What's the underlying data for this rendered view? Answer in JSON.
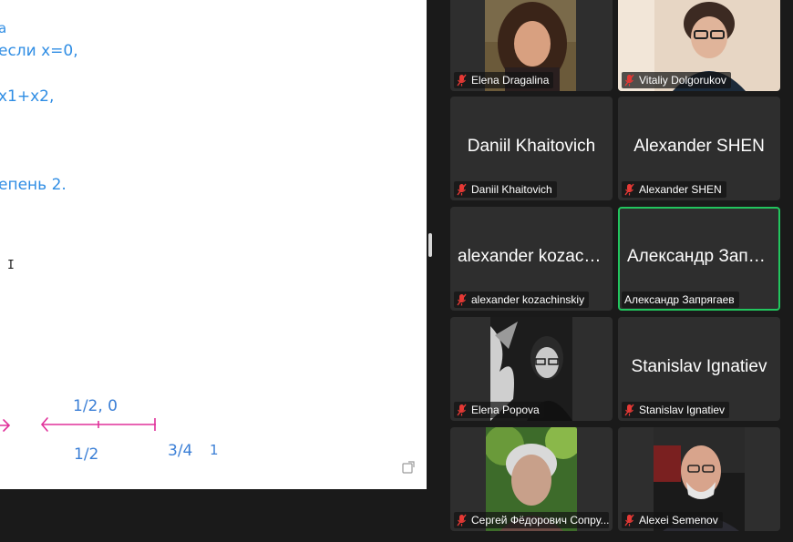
{
  "whiteboard": {
    "lines": [
      "а",
      "если x=0,",
      "x1+x2,",
      "епень 2."
    ],
    "number_line_labels": {
      "top": "1/2, 0",
      "under": "1/2",
      "three_quarters": "3/4",
      "one": "1"
    },
    "cursor": "I"
  },
  "participants": [
    {
      "name": "Elena Dragalina",
      "label": "Elena Dragalina",
      "video": true,
      "muted": true,
      "active": false
    },
    {
      "name": "Vitaliy Dolgorukov",
      "label": "Vitaliy Dolgorukov",
      "video": true,
      "muted": true,
      "active": false
    },
    {
      "name": "Daniil Khaitovich",
      "label": "Daniil Khaitovich",
      "video": false,
      "muted": true,
      "active": false
    },
    {
      "name": "Alexander SHEN",
      "label": "Alexander SHEN",
      "video": false,
      "muted": true,
      "active": false
    },
    {
      "name": "alexander kozach...",
      "label": "alexander kozachinskiy",
      "video": false,
      "muted": true,
      "active": false
    },
    {
      "name": "Александр Запр...",
      "label": "Александр Запрягаев",
      "video": false,
      "muted": false,
      "active": true
    },
    {
      "name": "Elena Popova",
      "label": "Elena Popova",
      "video": true,
      "muted": true,
      "active": false
    },
    {
      "name": "Stanislav Ignatiev",
      "label": "Stanislav Ignatiev",
      "video": false,
      "muted": true,
      "active": false
    },
    {
      "name": "Сергей Фёдорович Сопру...",
      "label": "Сергей Фёдорович Сопру...",
      "video": true,
      "muted": true,
      "active": false
    },
    {
      "name": "Alexei Semenov",
      "label": "Alexei Semenov",
      "video": true,
      "muted": true,
      "active": false
    }
  ],
  "colors": {
    "ink_blue": "#2f8de4",
    "ink_magenta": "#e0309a",
    "active_border": "#22c55e",
    "mute_red": "#e53935",
    "tile_bg": "#2e2e2e"
  }
}
